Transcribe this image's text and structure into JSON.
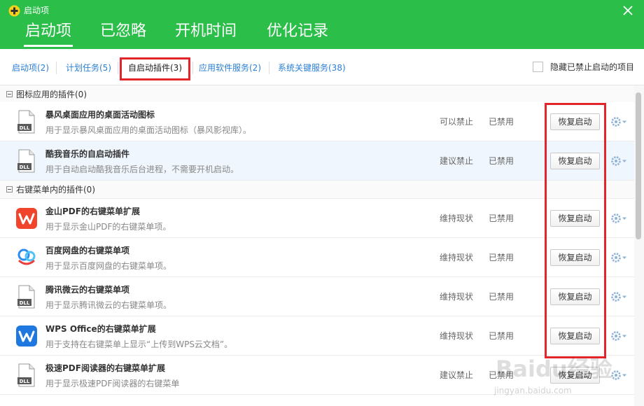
{
  "window": {
    "title": "启动项",
    "close_icon": "close-icon"
  },
  "main_tabs": [
    {
      "label": "启动项",
      "active": true
    },
    {
      "label": "已忽略"
    },
    {
      "label": "开机时间"
    },
    {
      "label": "优化记录"
    }
  ],
  "sub_tabs": [
    {
      "label": "启动项(2)"
    },
    {
      "label": "计划任务(5)"
    },
    {
      "label": "自启动插件(3)",
      "active": true
    },
    {
      "label": "应用软件服务(2)"
    },
    {
      "label": "系统关键服务(38)"
    }
  ],
  "hide_disabled": {
    "label": "隐藏已禁止启动的项目",
    "checked": false
  },
  "groups": [
    {
      "label": "图标应用的插件(0)"
    },
    {
      "label": "右键菜单内的插件(0)"
    }
  ],
  "items": [
    {
      "icon": "dll-file-icon",
      "name": "暴风桌面应用的桌面活动图标",
      "desc": "用于显示暴风桌面应用的桌面活动图标（暴风影视库）。",
      "advice": "可以禁止",
      "status": "已禁用",
      "action": "恢复启动"
    },
    {
      "icon": "dll-file-icon",
      "name": "酷我音乐的自启动插件",
      "desc": "用于自动启动酷我音乐后台进程，不需要开机启动。",
      "advice": "建议禁止",
      "status": "已禁用",
      "action": "恢复启动"
    },
    {
      "icon": "wps-pdf-icon",
      "name": "金山PDF的右键菜单扩展",
      "desc": "用于显示金山PDF的右键菜单项。",
      "advice": "维持现状",
      "status": "已禁用",
      "action": "恢复启动"
    },
    {
      "icon": "baidu-netdisk-icon",
      "name": "百度网盘的右键菜单项",
      "desc": "用于显示百度网盘的右键菜单项。",
      "advice": "维持现状",
      "status": "已禁用",
      "action": "恢复启动"
    },
    {
      "icon": "dll-file-icon",
      "name": "腾讯微云的右键菜单项",
      "desc": "用于显示腾讯微云的右键菜单项。",
      "advice": "维持现状",
      "status": "已禁用",
      "action": "恢复启动"
    },
    {
      "icon": "wps-office-icon",
      "name": "WPS Office的右键菜单扩展",
      "desc": "用于支持在右键菜单上显示“上传到WPS云文档”。",
      "advice": "维持现状",
      "status": "已禁用",
      "action": "恢复启动"
    },
    {
      "icon": "dll-file-icon",
      "name": "极速PDF阅读器的右键菜单扩展",
      "desc": "用于显示极速PDF阅读器的右键菜单",
      "advice": "建议禁止",
      "status": "已禁用",
      "action": "恢复启动"
    }
  ],
  "watermark": {
    "text": "Baidu经验",
    "sub": "jingyan.baidu.com"
  },
  "colors": {
    "header": "#2bbf4a",
    "link": "#2a7fd4",
    "highlight": "#e2252b",
    "selected_row": "#f0f6fd"
  }
}
